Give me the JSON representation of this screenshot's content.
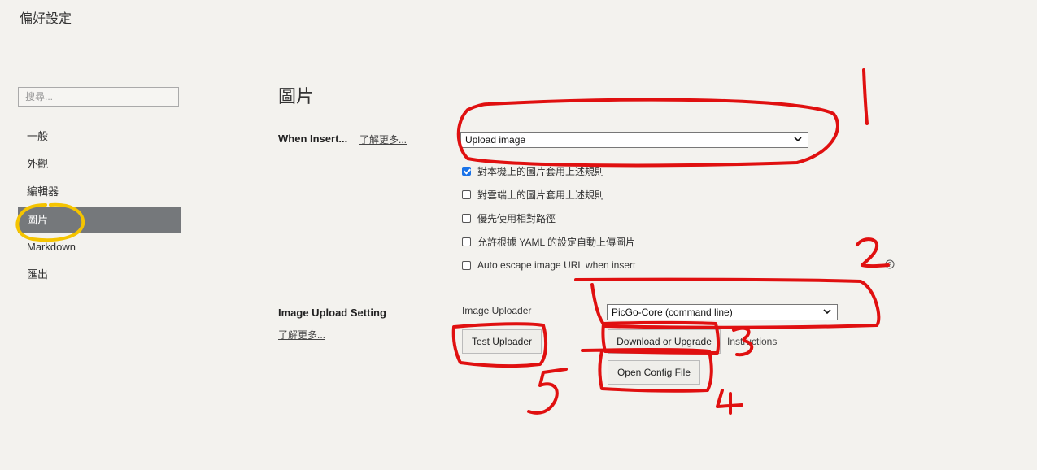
{
  "window": {
    "title": "偏好設定"
  },
  "sidebar": {
    "search_placeholder": "搜尋...",
    "items": [
      {
        "label": "一般",
        "active": false
      },
      {
        "label": "外觀",
        "active": false
      },
      {
        "label": "編輯器",
        "active": false
      },
      {
        "label": "圖片",
        "active": true
      },
      {
        "label": "Markdown",
        "active": false
      },
      {
        "label": "匯出",
        "active": false
      }
    ]
  },
  "main": {
    "title": "圖片",
    "when_insert": {
      "label": "When Insert...",
      "learn_more": "了解更多...",
      "selected": "Upload image"
    },
    "options": [
      {
        "label": "對本機上的圖片套用上述規則",
        "checked": true
      },
      {
        "label": "對雲端上的圖片套用上述規則",
        "checked": false
      },
      {
        "label": "優先使用相對路徑",
        "checked": false
      },
      {
        "label": "允許根據 YAML 的設定自動上傳圖片",
        "checked": false
      },
      {
        "label": "Auto escape image URL when insert",
        "checked": false
      }
    ],
    "upload_setting": {
      "label": "Image Upload Setting",
      "learn_more": "了解更多...",
      "uploader_label": "Image Uploader",
      "uploader_selected": "PicGo-Core (command line)",
      "test_button": "Test Uploader",
      "download_button": "Download or Upgrade",
      "instructions_link": "Instructions",
      "open_config_button": "Open Config File"
    }
  },
  "annotations": {
    "numbers": [
      "1",
      "2",
      "3",
      "4",
      "5"
    ],
    "red_color": "#e01010",
    "yellow_color": "#f5c400"
  }
}
